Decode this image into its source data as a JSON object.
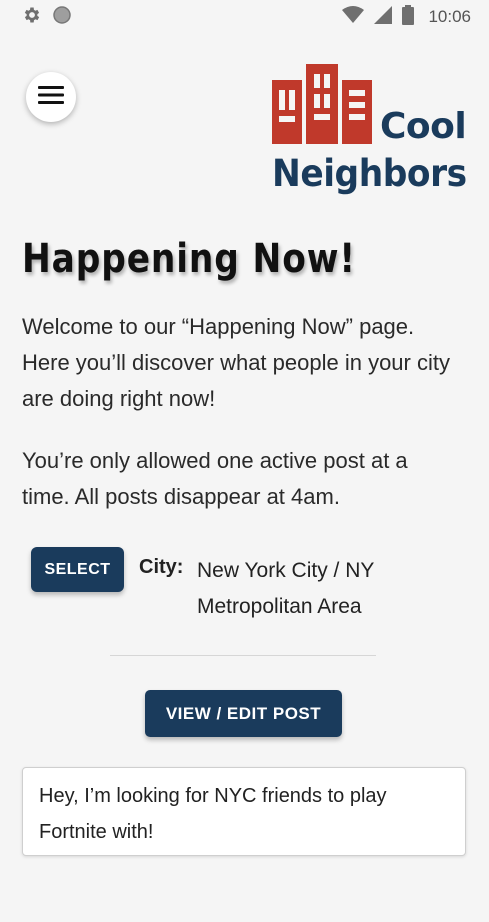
{
  "status_bar": {
    "time": "10:06",
    "icons": [
      "settings-icon",
      "circle-icon",
      "wifi-icon",
      "signal-icon",
      "battery-icon"
    ]
  },
  "header": {
    "menu_icon": "hamburger-icon",
    "logo": {
      "line1": "Cool",
      "line2": "Neighbors"
    }
  },
  "page": {
    "title": "Happening Now!",
    "intro": "Welcome to our “Happening Now” page. Here you’ll discover what people in your city are doing right now!",
    "rules": "You’re only allowed one active post at a time.  All posts disappear at 4am."
  },
  "city": {
    "select_label": "SELECT",
    "label": "City:",
    "value": "New York City / NY Metropolitan Area"
  },
  "post": {
    "view_edit_label": "VIEW / EDIT POST",
    "text": "Hey, I’m looking for NYC friends to play Fortnite with!"
  },
  "colors": {
    "primary": "#1a3b5c",
    "logo_red": "#c0392b",
    "background": "#f5f5f5"
  }
}
